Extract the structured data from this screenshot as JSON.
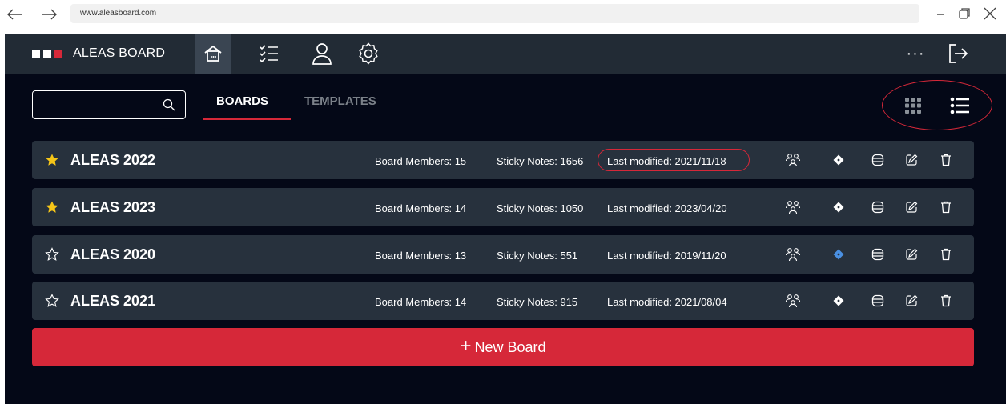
{
  "browser": {
    "url": "www.aleasboard.com",
    "back_icon": "arrow-left-icon",
    "forward_icon": "arrow-right-icon",
    "minimize_icon": "minimize-icon",
    "restore_icon": "restore-icon",
    "close_icon": "close-icon"
  },
  "app": {
    "brand_name": "ALEAS BOARD",
    "brand_colors": [
      "#ffffff",
      "#ffffff",
      "#d62839"
    ],
    "nav_icons": [
      "home-icon",
      "checklist-icon",
      "user-icon",
      "settings-icon"
    ],
    "more_label": "···",
    "logout_icon": "logout-icon",
    "accent_color": "#d62839"
  },
  "toolbar": {
    "search_placeholder": "",
    "tabs": [
      {
        "label": "BOARDS",
        "active": true
      },
      {
        "label": "TEMPLATES",
        "active": false
      }
    ],
    "view_icons": [
      "grid-view-icon",
      "list-view-icon"
    ]
  },
  "boards": [
    {
      "name": "ALEAS 2022",
      "favorite": true,
      "members": "Board Members: 15",
      "notes": "Sticky Notes: 1656",
      "modified": "Last modified: 2021/11/18",
      "highlight_modified": true,
      "diamond_color": "#ffffff"
    },
    {
      "name": "ALEAS 2023",
      "favorite": true,
      "members": "Board Members: 14",
      "notes": "Sticky Notes: 1050",
      "modified": "Last modified: 2023/04/20",
      "highlight_modified": false,
      "diamond_color": "#ffffff"
    },
    {
      "name": "ALEAS 2020",
      "favorite": false,
      "members": "Board Members: 13",
      "notes": "Sticky Notes: 551",
      "modified": "Last modified: 2019/11/20",
      "highlight_modified": false,
      "diamond_color": "#4a90e2"
    },
    {
      "name": "ALEAS 2021",
      "favorite": false,
      "members": "Board Members: 14",
      "notes": "Sticky Notes: 915",
      "modified": "Last modified: 2021/08/04",
      "highlight_modified": false,
      "diamond_color": "#ffffff"
    }
  ],
  "row_icons": [
    "members-icon",
    "diamond-icon",
    "database-icon",
    "edit-icon",
    "trash-icon"
  ],
  "new_board": {
    "plus": "+",
    "label": "New Board"
  }
}
